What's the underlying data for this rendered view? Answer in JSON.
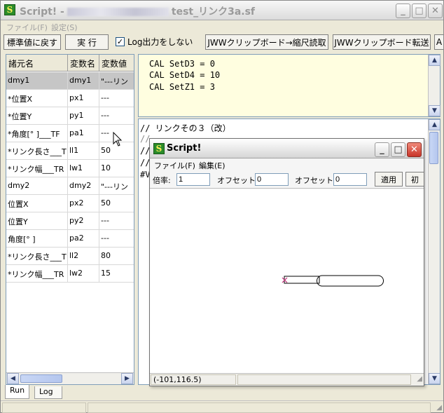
{
  "window": {
    "title_prefix": "Script! -",
    "title_file": "test_リンク3a.sf",
    "menu": [
      "ファイル(F)",
      "設定(S)"
    ]
  },
  "toolbar": {
    "reset_label": "標準値に戻す",
    "run_label": "実 行",
    "nolog_label": "Log出力をしない",
    "nolog_checked": true,
    "read_label": "JWWクリップボード→縮尺読取",
    "send_label": "JWWクリップボード転送",
    "extra_label": "A"
  },
  "table": {
    "headers": [
      "諸元名",
      "変数名",
      "変数値"
    ],
    "rows": [
      {
        "name": "dmy1",
        "var": "dmy1",
        "val": "\"---リン"
      },
      {
        "name": "*位置X",
        "var": "px1",
        "val": "---"
      },
      {
        "name": "*位置Y",
        "var": "py1",
        "val": "---"
      },
      {
        "name": "*角度[° ]___TF",
        "var": "pa1",
        "val": "---"
      },
      {
        "name": "*リンク長さ___T",
        "var": "ll1",
        "val": "50"
      },
      {
        "name": "*リンク幅___TR",
        "var": "lw1",
        "val": "10"
      },
      {
        "name": "dmy2",
        "var": "dmy2",
        "val": "\"---リン"
      },
      {
        "name": "位置X",
        "var": "px2",
        "val": "50"
      },
      {
        "name": "位置Y",
        "var": "py2",
        "val": "---"
      },
      {
        "name": "角度[° ]",
        "var": "pa2",
        "val": "---"
      },
      {
        "name": "*リンク長さ___T",
        "var": "ll2",
        "val": "80"
      },
      {
        "name": "*リンク幅___TR",
        "var": "lw2",
        "val": "15"
      }
    ]
  },
  "code": {
    "lines": [
      "CAL SetD3 = 0",
      "CAL SetD4 = 10",
      "CAL SetZ1 = 3"
    ]
  },
  "script": {
    "lines": [
      "// リンクその３（改）",
      "//",
      "//",
      "//",
      "#V"
    ]
  },
  "tabs": [
    "Run",
    "Log"
  ],
  "dialog": {
    "title": "Script!",
    "menu": [
      "ファイル(F)",
      "編集(E)"
    ],
    "scale_label": "倍率:",
    "scale_value": "1",
    "offset_x_label": "オフセットX:",
    "offset_x_value": "0",
    "offset_y_label": "オフセットY:",
    "offset_y_value": "0",
    "apply_label": "適用",
    "init_label": "初",
    "coord_readout": "(-101,116.5)"
  },
  "colors": {
    "code_bg": "#fffee0",
    "selected_row": "#c6c6c6",
    "close_button": "#d9463a",
    "marker": "#c0307a"
  }
}
